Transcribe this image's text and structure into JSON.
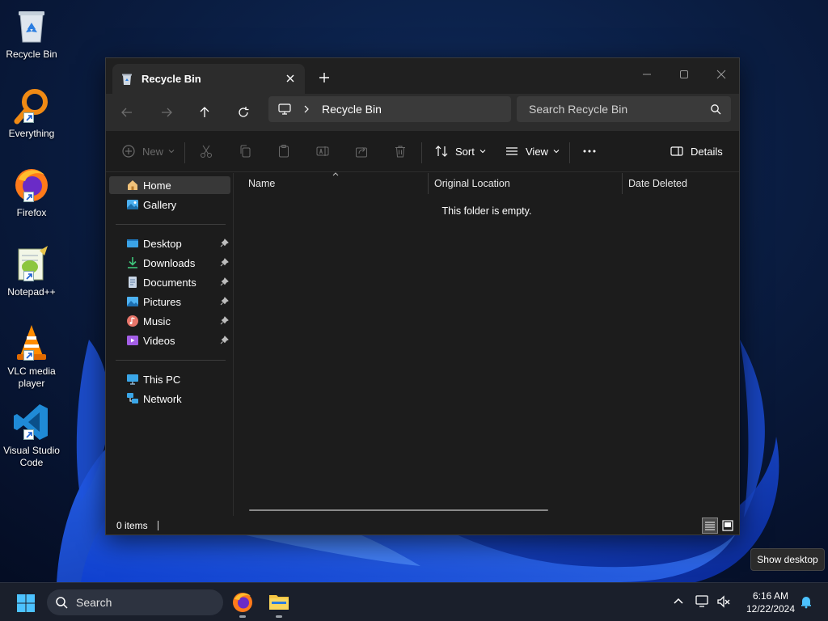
{
  "desktop": {
    "icons": [
      {
        "label": "Recycle Bin",
        "icon": "recycle-bin-icon"
      },
      {
        "label": "Everything",
        "icon": "everything-icon"
      },
      {
        "label": "Firefox",
        "icon": "firefox-icon"
      },
      {
        "label": "Notepad++",
        "icon": "notepad-plus-plus-icon"
      },
      {
        "label": "VLC media player",
        "icon": "vlc-icon"
      },
      {
        "label": "Visual Studio Code",
        "icon": "vscode-icon"
      }
    ]
  },
  "explorer": {
    "tab_title": "Recycle Bin",
    "address": {
      "crumb": "Recycle Bin"
    },
    "search": {
      "placeholder": "Search Recycle Bin"
    },
    "toolbar": {
      "new_label": "New",
      "sort_label": "Sort",
      "view_label": "View",
      "details_label": "Details"
    },
    "sidebar": {
      "top": [
        {
          "label": "Home",
          "icon": "home-icon",
          "active": true
        },
        {
          "label": "Gallery",
          "icon": "gallery-icon"
        }
      ],
      "pinned": [
        {
          "label": "Desktop",
          "icon": "desktop-folder-icon"
        },
        {
          "label": "Downloads",
          "icon": "downloads-icon"
        },
        {
          "label": "Documents",
          "icon": "documents-icon"
        },
        {
          "label": "Pictures",
          "icon": "pictures-icon"
        },
        {
          "label": "Music",
          "icon": "music-icon"
        },
        {
          "label": "Videos",
          "icon": "videos-icon"
        }
      ],
      "bottom": [
        {
          "label": "This PC",
          "icon": "this-pc-icon"
        },
        {
          "label": "Network",
          "icon": "network-icon"
        }
      ]
    },
    "columns": [
      "Name",
      "Original Location",
      "Date Deleted"
    ],
    "empty_message": "This folder is empty.",
    "status": {
      "item_count": "0 items"
    }
  },
  "tooltip": "Show desktop",
  "taskbar": {
    "search_label": "Search",
    "clock": {
      "time": "6:16 AM",
      "date": "12/22/2024"
    }
  },
  "colors": {
    "window_bg": "#1c1c1c",
    "accent": "#4cc2ff",
    "wallpaper": "#0a3aa8"
  }
}
